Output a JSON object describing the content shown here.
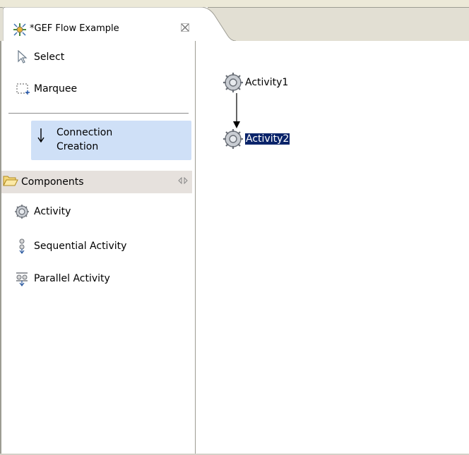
{
  "window": {
    "tab_title": "*GEF Flow Example",
    "close_icon": "close-icon",
    "tab_icon": "gef-flow-icon"
  },
  "palette": {
    "tools": [
      {
        "label": "Select",
        "icon": "arrow-pointer-icon"
      },
      {
        "label": "Marquee",
        "icon": "marquee-icon"
      }
    ],
    "connection_tool": {
      "label_line1": "Connection",
      "label_line2": "Creation",
      "icon": "arrow-down-icon",
      "selected": true
    },
    "drawer": {
      "label": "Components",
      "icon": "folder-open-icon",
      "pin_icon": "pin-icon"
    },
    "entries": [
      {
        "label": "Activity",
        "icon": "gear-icon"
      },
      {
        "label": "Sequential Activity",
        "icon": "sequential-activity-icon"
      },
      {
        "label": "Parallel Activity",
        "icon": "parallel-activity-icon"
      }
    ]
  },
  "canvas": {
    "nodes": [
      {
        "label": "Activity1",
        "selected": false
      },
      {
        "label": "Activity2",
        "selected": true
      }
    ],
    "connection": {
      "from": "Activity1",
      "to": "Activity2"
    }
  },
  "colors": {
    "selection_highlight": "#0a246a",
    "tool_selected_bg": "#cfe0f7",
    "drawer_bg": "#e6e1dd"
  }
}
